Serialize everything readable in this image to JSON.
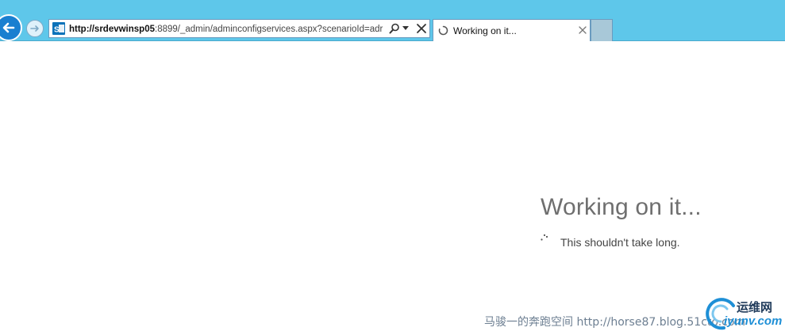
{
  "browser": {
    "address_bar": {
      "url_host": "http://srdevwinsp05",
      "url_rest": ":8899/_admin/adminconfigservices.aspx?scenarioId=adr"
    },
    "tab": {
      "title": "Working on it..."
    },
    "icons": [
      "back-icon",
      "forward-icon",
      "sharepoint-icon",
      "search-icon",
      "dropdown-icon",
      "stop-icon",
      "loading-spinner-icon",
      "close-icon"
    ]
  },
  "page": {
    "heading": "Working on it...",
    "message": "This shouldn't take long."
  },
  "watermark": {
    "text": "马骏一的奔跑空间 http://horse87.blog.51cto.com",
    "logo_top": "运维网",
    "logo_bottom": "iyunv.com"
  },
  "colors": {
    "titlebar": "#5ec7ea",
    "back_button": "#1a7fd0",
    "heading_text": "#6f6f6f"
  }
}
